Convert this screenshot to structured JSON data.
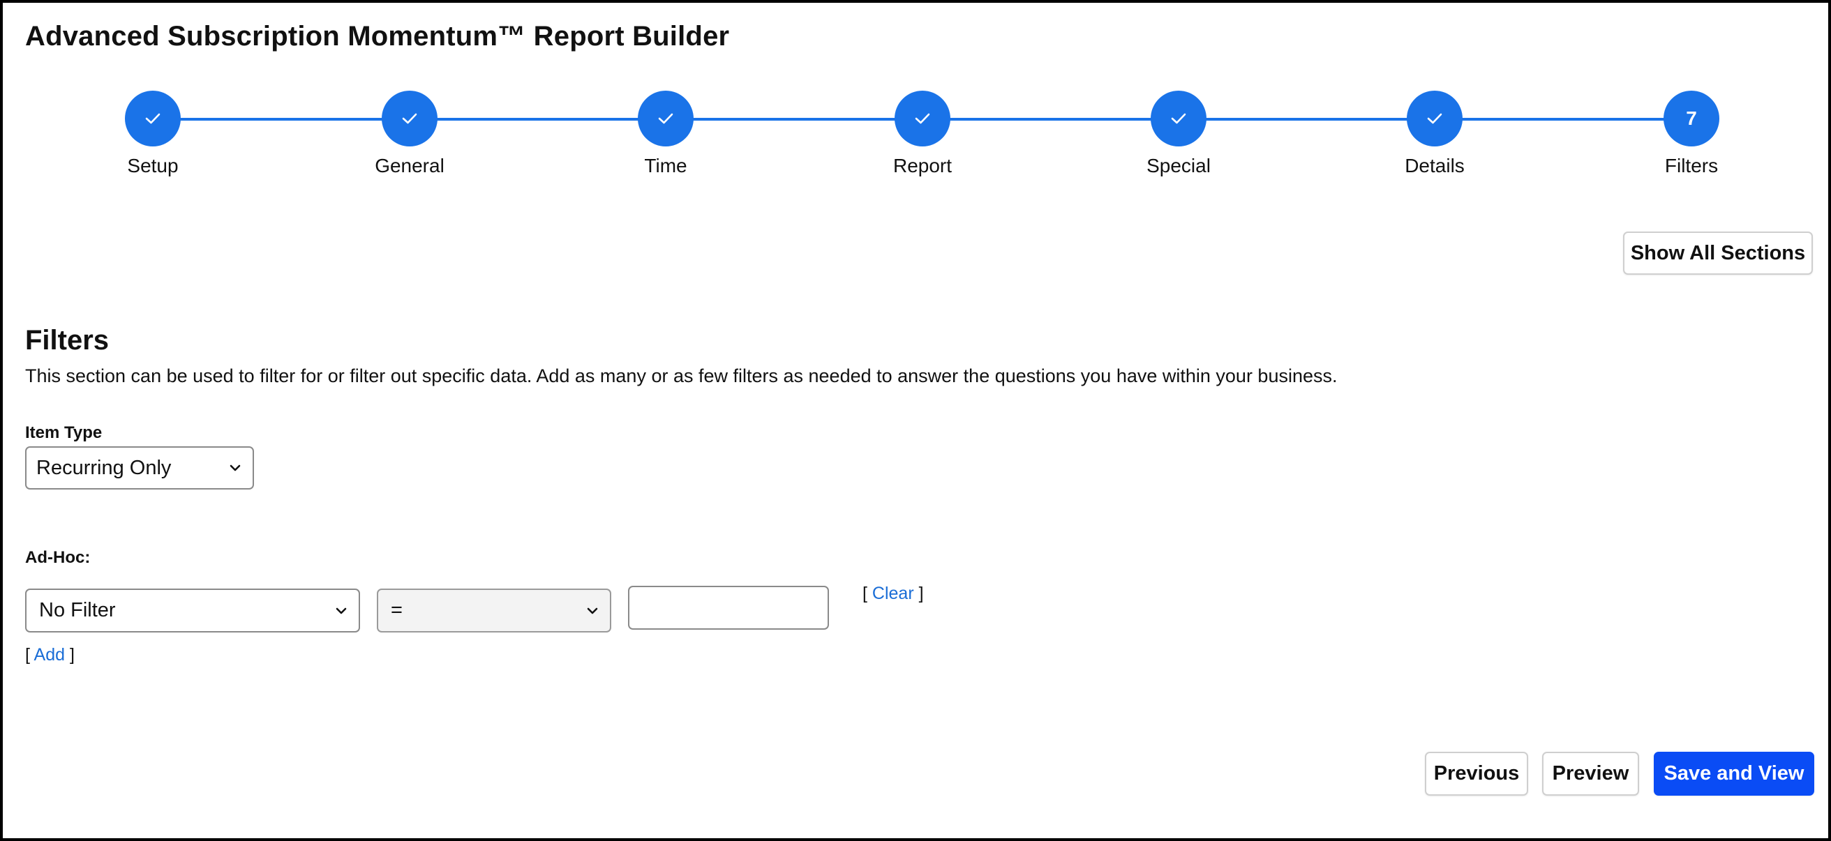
{
  "page": {
    "title": "Advanced Subscription Momentum™ Report Builder"
  },
  "colors": {
    "accent": "#1a73e8",
    "primary_button": "#0a4cf5",
    "link": "#1a6dd6"
  },
  "stepper": {
    "steps": [
      {
        "label": "Setup",
        "state": "complete",
        "icon": "check-icon"
      },
      {
        "label": "General",
        "state": "complete",
        "icon": "check-icon"
      },
      {
        "label": "Time",
        "state": "complete",
        "icon": "check-icon"
      },
      {
        "label": "Report",
        "state": "complete",
        "icon": "check-icon"
      },
      {
        "label": "Special",
        "state": "complete",
        "icon": "check-icon"
      },
      {
        "label": "Details",
        "state": "complete",
        "icon": "check-icon"
      },
      {
        "label": "Filters",
        "state": "current",
        "number": "7"
      }
    ]
  },
  "toolbar": {
    "show_all_label": "Show All Sections"
  },
  "filters": {
    "heading": "Filters",
    "description": "This section can be used to filter for or filter out specific data. Add as many or as few filters as needed to answer the questions you have within your business.",
    "item_type": {
      "label": "Item Type",
      "selected": "Recurring Only"
    },
    "adhoc": {
      "label": "Ad-Hoc:",
      "field_selected": "No Filter",
      "operator_selected": "=",
      "value": "",
      "clear_open": "[",
      "clear_label": "Clear",
      "clear_close": "]",
      "add_open": "[",
      "add_label": "Add",
      "add_close": "]"
    }
  },
  "footer": {
    "previous_label": "Previous",
    "preview_label": "Preview",
    "save_label": "Save and View"
  }
}
